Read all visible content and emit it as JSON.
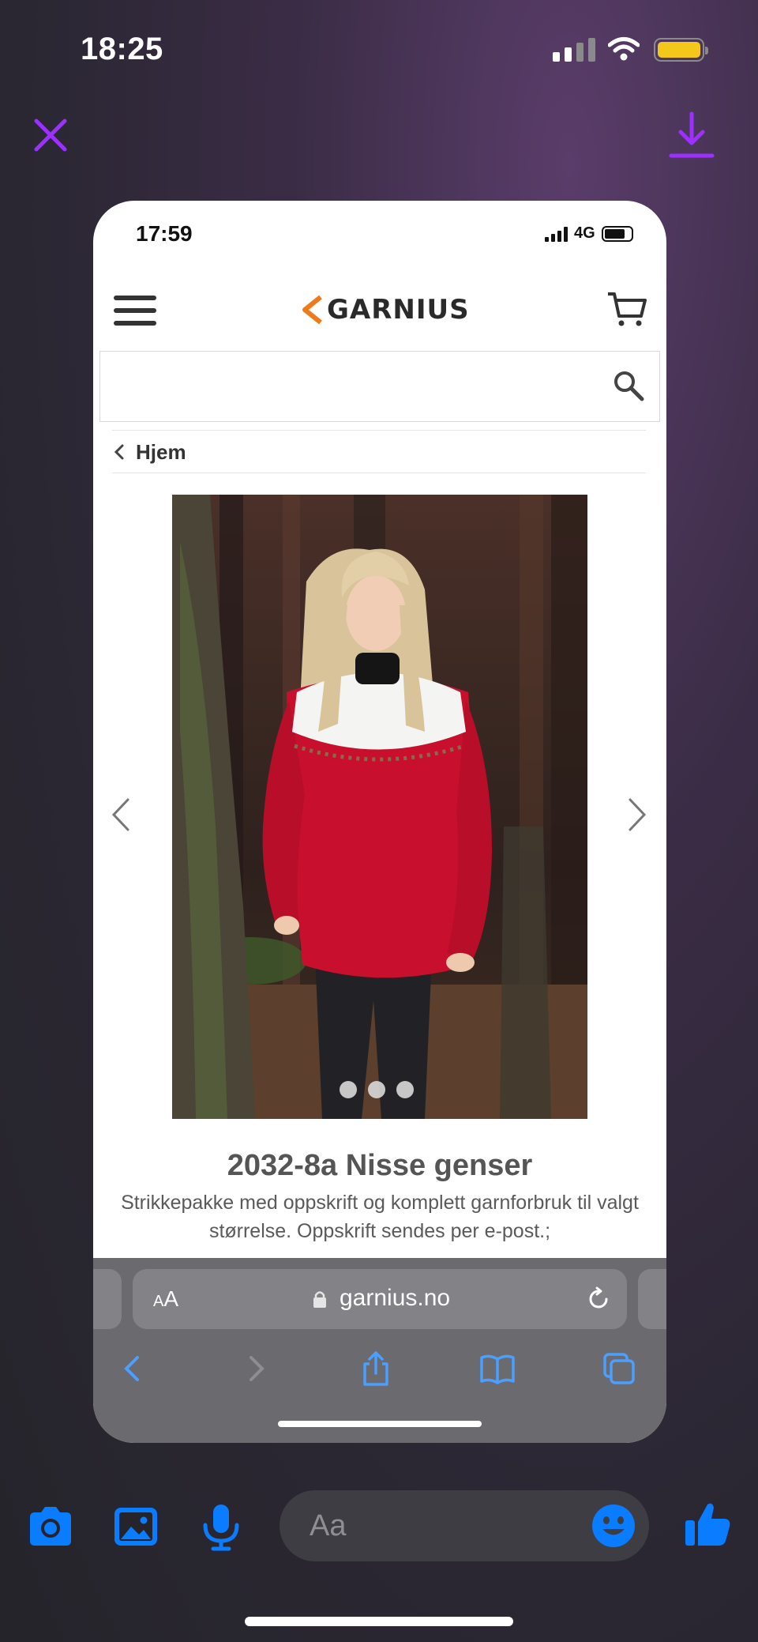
{
  "status_bar": {
    "time": "18:25"
  },
  "viewer": {
    "close_icon": "close-icon",
    "download_icon": "download-icon",
    "accent": "#9b30ff"
  },
  "screenshot": {
    "status_bar": {
      "time": "17:59",
      "network": "4G"
    },
    "header": {
      "logo_text": "GARNIUS",
      "logo_accent": "#f07a1a",
      "menu_icon": "hamburger-icon",
      "cart_icon": "cart-icon"
    },
    "search": {
      "placeholder": "",
      "icon": "search-icon"
    },
    "breadcrumb": {
      "label": "Hjem"
    },
    "product": {
      "title": "2032-8a Nisse genser",
      "description": "Strikkepakke med oppskrift og komplett garnforbruk til valgt størrelse. Oppskrift sendes per e-post.;",
      "carousel_dots": 3,
      "sweater_color": "#c8102e"
    },
    "browser": {
      "text_size": "AA",
      "url": "garnius.no",
      "toolbar_icons": [
        "back-icon",
        "forward-icon",
        "share-icon",
        "bookmarks-icon",
        "tabs-icon"
      ],
      "tint": "#4a9fff"
    }
  },
  "composer": {
    "placeholder": "Aa",
    "icons": [
      "camera-icon",
      "photo-icon",
      "microphone-icon",
      "emoji-icon",
      "thumbs-up-icon"
    ],
    "accent": "#0a7cff"
  }
}
